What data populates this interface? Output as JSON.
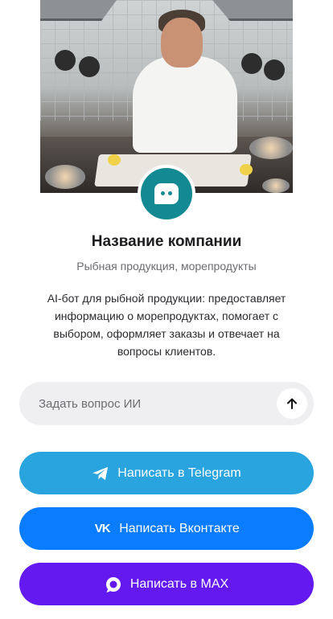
{
  "company": {
    "name": "Название компании",
    "category": "Рыбная продукция, морепродукты",
    "description": "AI-бот для рыбной продукции: предоставляет информацию о морепродуктах, помогает с выбором, оформляет заказы и отвечает на вопросы клиентов."
  },
  "ask": {
    "placeholder": "Задать вопрос ИИ",
    "value": ""
  },
  "buttons": {
    "telegram": {
      "label": "Написать в Telegram",
      "color": "#2aa4df"
    },
    "vk": {
      "label": "Написать Вконтакте",
      "color": "#0a7cff",
      "icon_text": "VK"
    },
    "max": {
      "label": "Написать в MAX",
      "color": "#6419f0"
    }
  },
  "colors": {
    "avatar": "#138a93",
    "input_bg": "#efeff1"
  },
  "icons": {
    "avatar": "chat-bot-icon",
    "send": "arrow-up-icon",
    "telegram": "telegram-icon",
    "vk": "vk-icon",
    "max": "max-icon"
  }
}
